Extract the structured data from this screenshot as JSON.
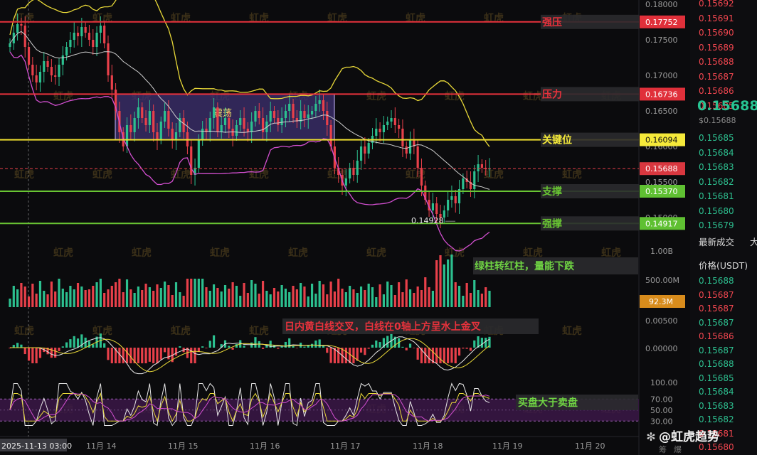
{
  "chart_data": {
    "type": "candlestick",
    "watermark": "虹虎",
    "time_axis": {
      "labels": [
        "2025-11-13 03:00",
        "11月 14",
        "11月 15",
        "11月 16",
        "11月 17",
        "11月 18",
        "11月 19",
        "11月 20"
      ]
    },
    "price_axis": {
      "ylim": [
        0.1481,
        0.1806
      ],
      "ticks": [
        "0.18000",
        "0.17500",
        "0.17000",
        "0.16500",
        "0.16000",
        "0.15500",
        "0.15000"
      ]
    },
    "levels": [
      {
        "name": "强压",
        "value": 0.17752,
        "value_label": "0.17752",
        "color": "#e8323c"
      },
      {
        "name": "压力",
        "value": 0.16736,
        "value_label": "0.16736",
        "color": "#e8323c"
      },
      {
        "name": "关键位",
        "value": 0.16094,
        "value_label": "0.16094",
        "color": "#f0e030"
      },
      {
        "name": "支撑",
        "value": 0.1537,
        "value_label": "0.15370",
        "color": "#69c533"
      },
      {
        "name": "强撑",
        "value": 0.14917,
        "value_label": "0.14917",
        "color": "#69c533"
      }
    ],
    "current_price": {
      "value": 0.15688,
      "label": "0.15688"
    },
    "low_marker": {
      "label": "0.14928",
      "value": 0.14928
    },
    "range_box": {
      "label": "震荡",
      "from": 0.16736,
      "to": 0.16094
    },
    "candles": [
      0.1745,
      0.176,
      0.1772,
      0.177,
      0.174,
      0.1715,
      0.17,
      0.169,
      0.1705,
      0.172,
      0.1712,
      0.17,
      0.1698,
      0.1715,
      0.1728,
      0.174,
      0.175,
      0.176,
      0.1755,
      0.1768,
      0.176,
      0.175,
      0.174,
      0.176,
      0.177,
      0.1745,
      0.17,
      0.168,
      0.165,
      0.162,
      0.16,
      0.163,
      0.162,
      0.164,
      0.1655,
      0.164,
      0.163,
      0.165,
      0.162,
      0.161,
      0.1635,
      0.165,
      0.1625,
      0.161,
      0.162,
      0.164,
      0.162,
      0.16,
      0.156,
      0.157,
      0.161,
      0.1625,
      0.162,
      0.164,
      0.1655,
      0.162,
      0.163,
      0.164,
      0.1625,
      0.1615,
      0.163,
      0.164,
      0.1625,
      0.162,
      0.1635,
      0.165,
      0.164,
      0.162,
      0.1635,
      0.165,
      0.164,
      0.163,
      0.164,
      0.165,
      0.166,
      0.164,
      0.1635,
      0.165,
      0.164,
      0.1645,
      0.165,
      0.166,
      0.1665,
      0.165,
      0.163,
      0.16,
      0.157,
      0.156,
      0.1545,
      0.1555,
      0.157,
      0.156,
      0.158,
      0.16,
      0.159,
      0.1605,
      0.1615,
      0.1625,
      0.162,
      0.163,
      0.1635,
      0.164,
      0.163,
      0.1625,
      0.16,
      0.159,
      0.161,
      0.16,
      0.157,
      0.1545,
      0.1525,
      0.151,
      0.152,
      0.1505,
      0.15,
      0.151,
      0.1525,
      0.153,
      0.152,
      0.154,
      0.1555,
      0.155,
      0.154,
      0.1565,
      0.1575,
      0.157,
      0.1568,
      0.15688
    ],
    "indicators": {
      "volume": {
        "tick_top": "1.00B",
        "tick_mid": "500.00M",
        "last_label": "92.3M",
        "note": "绿柱转红柱，量能下跌"
      },
      "macd": {
        "tick_top": "0.00500",
        "tick_zero": "0.00000",
        "note": "日内黄白线交叉，白线在0轴上方呈水上金叉"
      },
      "kdj": {
        "ticks": [
          "100.00",
          "70.00",
          "50.00",
          "30.00"
        ],
        "note": "买盘大于卖盘"
      }
    }
  },
  "orderbook": {
    "asks_top": [
      "0.15692",
      "0.15691",
      "0.15690",
      "0.15689",
      "0.15688",
      "0.15687",
      "0.15686",
      "0.15685"
    ],
    "last_price": "0.15688",
    "last_price_sub": "$0.15688",
    "bids_top": [
      "0.15685",
      "0.15684",
      "0.15683",
      "0.15682",
      "0.15681",
      "0.15680",
      "0.15679"
    ],
    "trades_title": "最新成交",
    "trades_title_cut": "大",
    "price_header": "价格(USDT)",
    "trades": [
      {
        "p": "0.15688",
        "c": "green"
      },
      {
        "p": "0.15687",
        "c": "red"
      },
      {
        "p": "0.15687",
        "c": "red"
      },
      {
        "p": "0.15687",
        "c": "green"
      },
      {
        "p": "0.15686",
        "c": "red"
      },
      {
        "p": "0.15687",
        "c": "green"
      },
      {
        "p": "0.15688",
        "c": "green"
      },
      {
        "p": "0.15685",
        "c": "green"
      },
      {
        "p": "0.15684",
        "c": "green"
      },
      {
        "p": "0.15683",
        "c": "green"
      },
      {
        "p": "0.15682",
        "c": "green"
      },
      {
        "p": "0.15681",
        "c": "red"
      },
      {
        "p": "0.15680",
        "c": "red"
      }
    ]
  },
  "brand": {
    "name": "@虹虎趋势",
    "footer_left": "筹",
    "footer_right": "爆"
  }
}
